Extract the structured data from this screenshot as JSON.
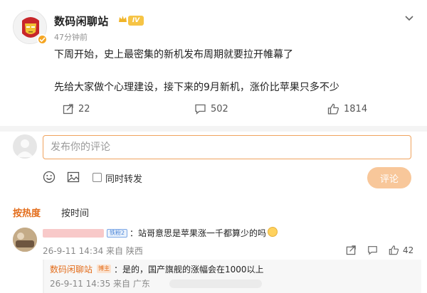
{
  "post": {
    "username": "数码闲聊站",
    "level_badge": "IV",
    "timestamp": "47分钟前",
    "lines": [
      "下周开始，史上最密集的新机发布周期就要拉开帷幕了",
      "先给大家做个心理建设，接下来的9月新机，涨价比苹果只多不少"
    ],
    "actions": {
      "repost_count": "22",
      "comment_count": "502",
      "like_count": "1814"
    }
  },
  "composer": {
    "placeholder": "发布你的评论",
    "repost_label": "同时转发",
    "submit_label": "评论"
  },
  "sort_tabs": {
    "hot": "按热度",
    "time": "按时间"
  },
  "comment": {
    "badge": "铁粉2",
    "text": "：站哥意思是苹果涨一千都算少的吗",
    "meta": "26-9-11 14:34 来自 陕西",
    "like_count": "42"
  },
  "reply": {
    "name": "数码闲聊站",
    "badge": "博主",
    "text": "：是的，国产旗舰的涨幅会在1000以上",
    "meta": "26-9-11 14:35 来自 广东"
  },
  "colors": {
    "accent": "#e36d1b",
    "input_border": "#f0a35e",
    "submit_bg": "#f8c79a",
    "verified": "#f5a623"
  }
}
